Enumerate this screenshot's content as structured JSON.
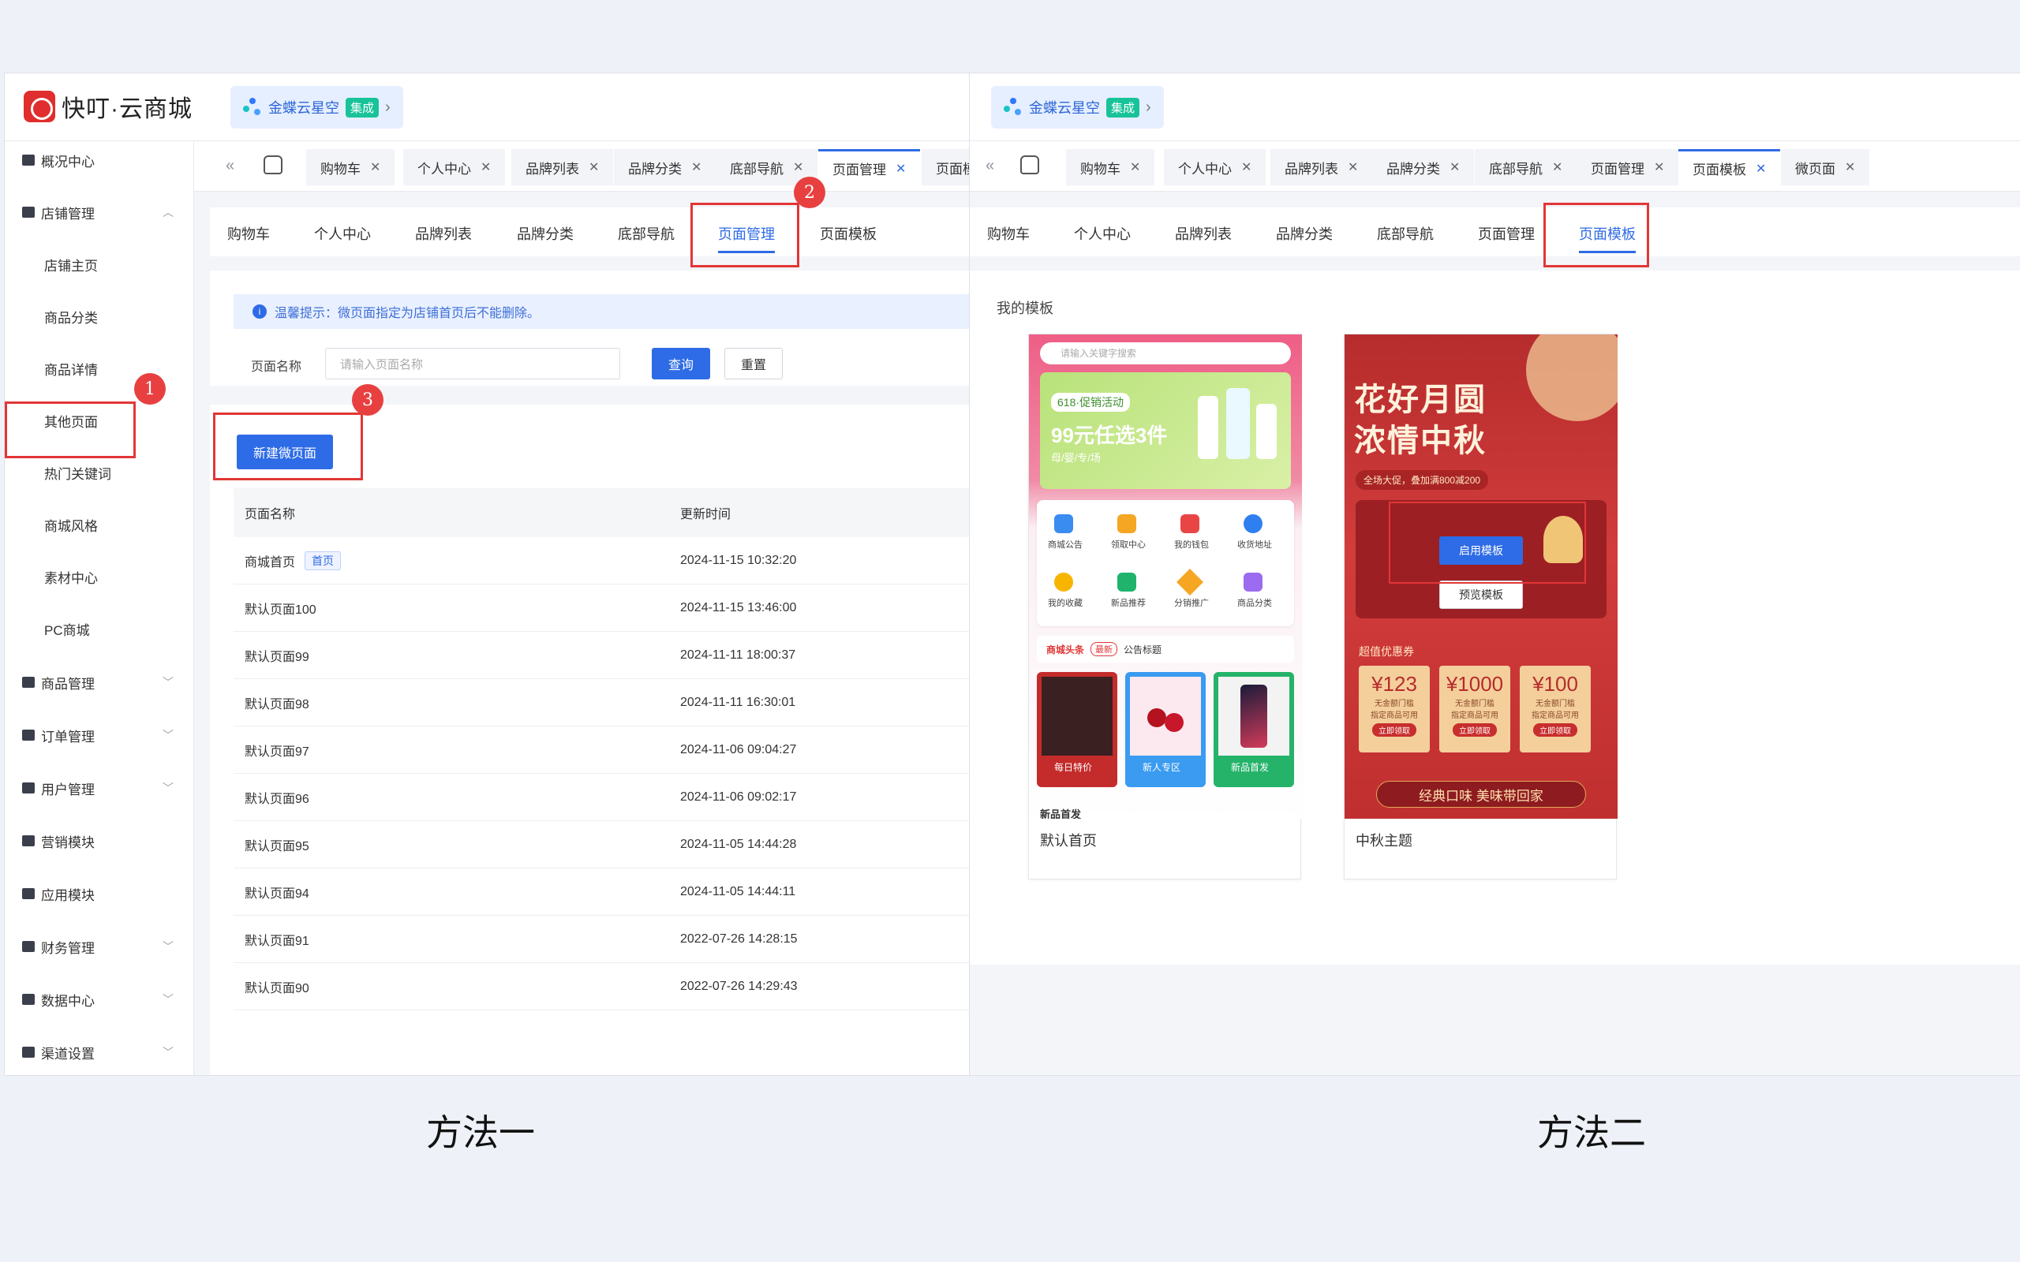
{
  "left": {
    "logo_text": "快叮·云商城",
    "integration": {
      "name": "金蝶云星空",
      "badge": "集成"
    },
    "sidebar": {
      "items": [
        {
          "label": "概况中心",
          "icon": "dashboard-icon",
          "chev": ""
        },
        {
          "label": "店铺管理",
          "icon": "store-icon",
          "chev": "^"
        },
        {
          "label": "店铺主页",
          "sub": true
        },
        {
          "label": "商品分类",
          "sub": true
        },
        {
          "label": "商品详情",
          "sub": true
        },
        {
          "label": "其他页面",
          "sub": true
        },
        {
          "label": "热门关键词",
          "sub": true
        },
        {
          "label": "商城风格",
          "sub": true
        },
        {
          "label": "素材中心",
          "sub": true
        },
        {
          "label": "PC商城",
          "sub": true
        },
        {
          "label": "商品管理",
          "icon": "goods-icon",
          "chev": "v"
        },
        {
          "label": "订单管理",
          "icon": "order-icon",
          "chev": "v"
        },
        {
          "label": "用户管理",
          "icon": "user-icon",
          "chev": "v"
        },
        {
          "label": "营销模块",
          "icon": "marketing-icon",
          "chev": ""
        },
        {
          "label": "应用模块",
          "icon": "apps-icon",
          "chev": ""
        },
        {
          "label": "财务管理",
          "icon": "finance-icon",
          "chev": "v"
        },
        {
          "label": "数据中心",
          "icon": "data-icon",
          "chev": "v"
        },
        {
          "label": "渠道设置",
          "icon": "channel-icon",
          "chev": "v"
        }
      ]
    },
    "tabs": [
      "购物车",
      "个人中心",
      "品牌列表",
      "品牌分类",
      "底部导航",
      "页面管理",
      "页面模"
    ],
    "subtabs": [
      "购物车",
      "个人中心",
      "品牌列表",
      "品牌分类",
      "底部导航",
      "页面管理",
      "页面模板"
    ],
    "notice": "温馨提示：微页面指定为店铺首页后不能删除。",
    "search": {
      "label": "页面名称",
      "placeholder": "请输入页面名称",
      "query": "查询",
      "reset": "重置"
    },
    "new_button": "新建微页面",
    "table": {
      "headers": [
        "页面名称",
        "更新时间"
      ],
      "rows": [
        {
          "name": "商城首页",
          "tag": "首页",
          "time": "2024-11-15 10:32:20"
        },
        {
          "name": "默认页面100",
          "time": "2024-11-15 13:46:00"
        },
        {
          "name": "默认页面99",
          "time": "2024-11-11 18:00:37"
        },
        {
          "name": "默认页面98",
          "time": "2024-11-11 16:30:01"
        },
        {
          "name": "默认页面97",
          "time": "2024-11-06 09:04:27"
        },
        {
          "name": "默认页面96",
          "time": "2024-11-06 09:02:17"
        },
        {
          "name": "默认页面95",
          "time": "2024-11-05 14:44:28"
        },
        {
          "name": "默认页面94",
          "time": "2024-11-05 14:44:11"
        },
        {
          "name": "默认页面91",
          "time": "2022-07-26 14:28:15"
        },
        {
          "name": "默认页面90",
          "time": "2022-07-26 14:29:43"
        }
      ]
    },
    "steps": [
      "1",
      "2",
      "3"
    ]
  },
  "right": {
    "integration": {
      "name": "金蝶云星空",
      "badge": "集成"
    },
    "tabs": [
      "购物车",
      "个人中心",
      "品牌列表",
      "品牌分类",
      "底部导航",
      "页面管理",
      "页面模板",
      "微页面"
    ],
    "subtabs": [
      "购物车",
      "个人中心",
      "品牌列表",
      "品牌分类",
      "底部导航",
      "页面管理",
      "页面模板"
    ],
    "section_title": "我的模板",
    "templates": [
      {
        "name": "默认首页",
        "search_placeholder": "请输入关键字搜索",
        "promo_tag": "618·促销活动",
        "promo_title": "99元任选3件",
        "promo_sub": "母/婴/专/场",
        "icons": [
          "商城公告",
          "领取中心",
          "我的钱包",
          "收货地址",
          "我的收藏",
          "新品推荐",
          "分销推广",
          "商品分类"
        ],
        "headline_brand": "商城头条",
        "headline_tag": "最新",
        "headline_text": "公告标题",
        "cards": [
          "每日特价",
          "新人专区",
          "新品首发"
        ],
        "bottom": "新品首发"
      },
      {
        "name": "中秋主题",
        "title1": "花好月圆",
        "title2": "浓情中秋",
        "subtitle": "全场大促，叠加满800减200",
        "use_btn": "启用模板",
        "preview_btn": "预览模板",
        "coupon_title": "超值优惠券",
        "coupons": [
          "¥123",
          "¥1000",
          "¥100"
        ],
        "coupon_line1": "无金额门槛",
        "coupon_line2": "指定商品可用",
        "coupon_btn": "立即领取",
        "banner": "经典口味 美味带回家"
      }
    ]
  },
  "captions": [
    "方法一",
    "方法二"
  ]
}
